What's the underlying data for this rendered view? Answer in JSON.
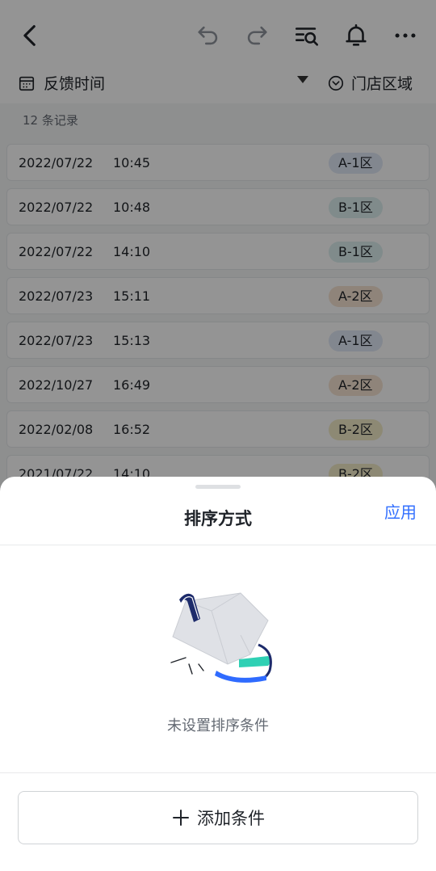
{
  "filter": {
    "left_label": "反馈时间",
    "right_label": "门店区域"
  },
  "record_count": "12 条记录",
  "records": [
    {
      "date": "2022/07/22",
      "time": "10:45",
      "area": "A-1区",
      "area_color": "#e1e8f7"
    },
    {
      "date": "2022/07/22",
      "time": "10:48",
      "area": "B-1区",
      "area_color": "#dcefef"
    },
    {
      "date": "2022/07/22",
      "time": "14:10",
      "area": "B-1区",
      "area_color": "#dcefef"
    },
    {
      "date": "2022/07/23",
      "time": "15:11",
      "area": "A-2区",
      "area_color": "#f7e4d2"
    },
    {
      "date": "2022/07/23",
      "time": "15:13",
      "area": "A-1区",
      "area_color": "#e1e8f7"
    },
    {
      "date": "2022/10/27",
      "time": "16:49",
      "area": "A-2区",
      "area_color": "#f7e4d2"
    },
    {
      "date": "2022/02/08",
      "time": "16:52",
      "area": "B-2区",
      "area_color": "#f3ecc9"
    },
    {
      "date": "2021/07/22",
      "time": "14:10",
      "area": "B-2区",
      "area_color": "#f3ecc9"
    }
  ],
  "sheet": {
    "title": "排序方式",
    "apply_label": "应用",
    "empty_text": "未设置排序条件",
    "add_button_label": "添加条件"
  },
  "colors": {
    "accent": "#3370ff"
  },
  "icons": [
    "back-icon",
    "undo-icon",
    "redo-icon",
    "search-list-icon",
    "bell-icon",
    "more-icon",
    "calendar-icon",
    "chevron-circle-icon",
    "plus-icon"
  ]
}
